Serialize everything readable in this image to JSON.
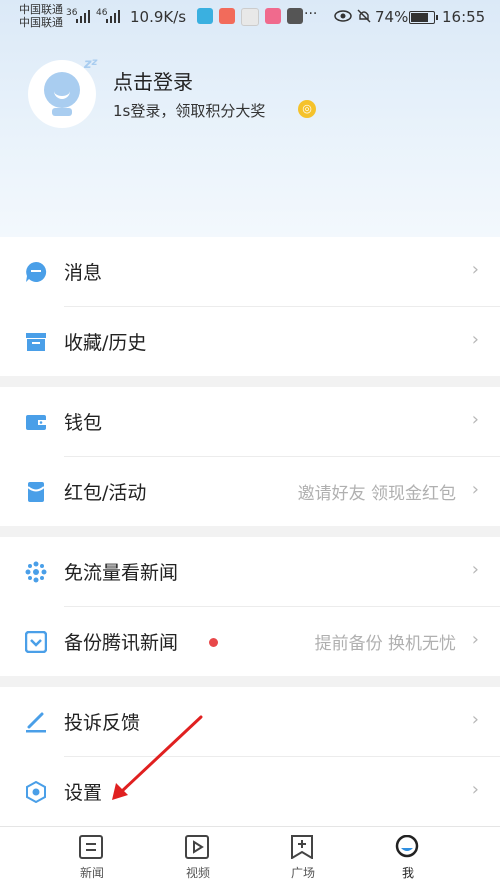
{
  "status_bar": {
    "carrier1": "中国联通",
    "carrier2": "中国联通",
    "sig1": "36",
    "sig2": "46",
    "net_speed": "10.9K/s",
    "more": "···",
    "battery": "74%",
    "time": "16:55"
  },
  "profile": {
    "login_title": "点击登录",
    "login_subtitle": "1s登录，领取积分大奖",
    "avatar_icon": "avatar-icon"
  },
  "menu": {
    "messages": "消息",
    "favorites": "收藏/历史",
    "wallet": "钱包",
    "redpacket": "红包/活动",
    "redpacket_hint": "邀请好友 领现金红包",
    "freeflow": "免流量看新闻",
    "backup": "备份腾讯新闻",
    "backup_hint": "提前备份 换机无忧",
    "feedback": "投诉反馈",
    "settings": "设置",
    "chevron": "›"
  },
  "tabbar": {
    "news": "新闻",
    "video": "视频",
    "square": "广场",
    "me": "我"
  },
  "colors": {
    "accent": "#2f8fe0",
    "icon_blue": "#4a9fe8",
    "red_dot": "#e8484a"
  }
}
